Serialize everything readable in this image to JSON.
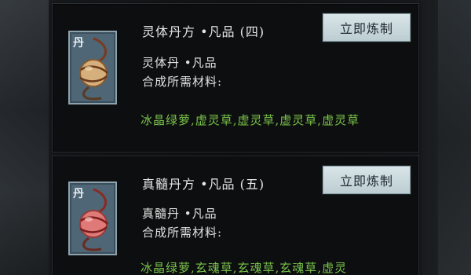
{
  "recipes": [
    {
      "title": "灵体丹方 •凡品 (四)",
      "button": "立即炼制",
      "icon_tag": "丹",
      "item_name": "灵体丹 •凡品",
      "materials_label": "合成所需材料:",
      "materials": "冰晶绿萝,虚灵草,虚灵草,虚灵草,虚灵草",
      "pill_color": "#d6b07c"
    },
    {
      "title": "真髓丹方 •凡品 (五)",
      "button": "立即炼制",
      "icon_tag": "丹",
      "item_name": "真髓丹 •凡品",
      "materials_label": "合成所需材料:",
      "materials": "冰晶绿萝,玄魂草,玄魂草,玄魂草,虚灵",
      "pill_color": "#e07a78"
    }
  ]
}
